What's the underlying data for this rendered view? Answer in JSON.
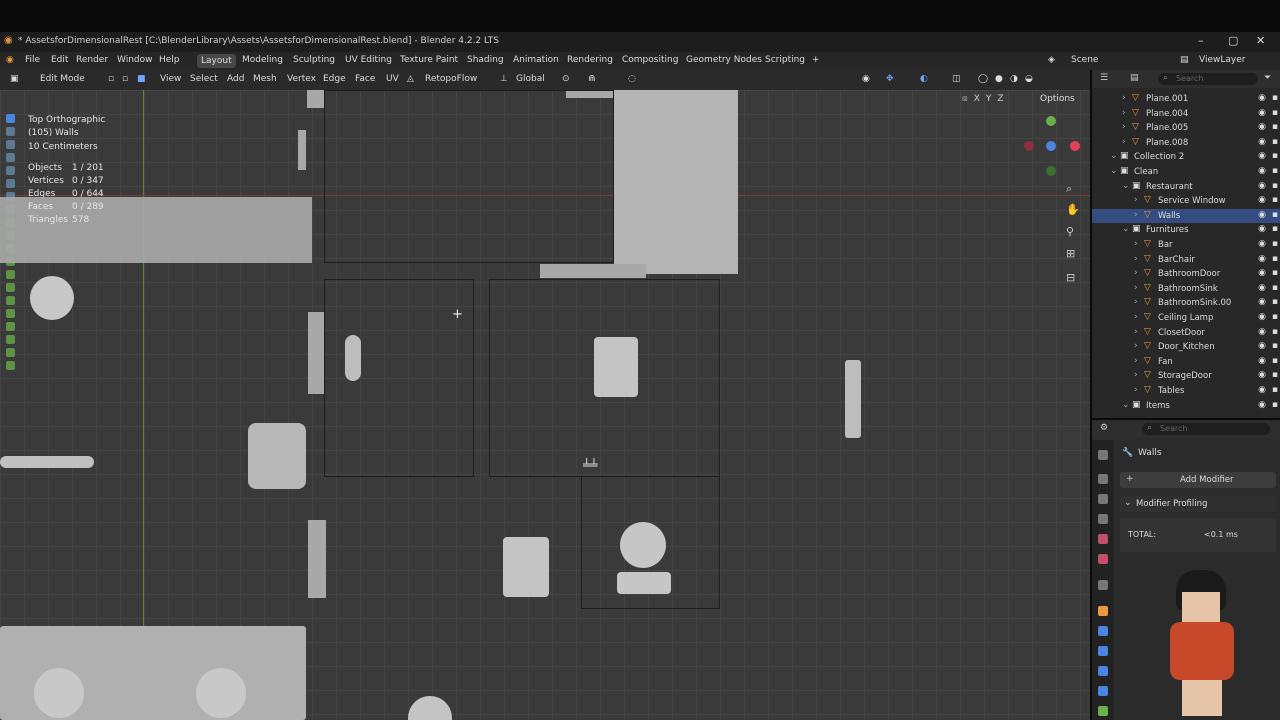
{
  "window": {
    "title": "* AssetsforDimensionalRest [C:\\BlenderLibrary\\Assets\\AssetsforDimensionalRest.blend] - Blender 4.2.2 LTS",
    "min_icon": "minimize-icon",
    "max_icon": "maximize-icon",
    "close_icon": "close-icon"
  },
  "menubar": {
    "menus": [
      "File",
      "Edit",
      "Render",
      "Window",
      "Help"
    ],
    "workspaces": [
      "Layout",
      "Modeling",
      "Sculpting",
      "UV Editing",
      "Texture Paint",
      "Shading",
      "Animation",
      "Rendering",
      "Compositing",
      "Geometry Nodes",
      "Scripting",
      "+"
    ],
    "active_workspace": "Layout",
    "scene": "Scene",
    "view_layer": "ViewLayer"
  },
  "viewport_header": {
    "mode": "Edit Mode",
    "menus": [
      "View",
      "Select",
      "Add",
      "Mesh",
      "Vertex",
      "Edge",
      "Face",
      "UV"
    ],
    "addon": "RetopoFlow",
    "orientation": "Global",
    "options": "Options",
    "axes": [
      "X",
      "Y",
      "Z"
    ]
  },
  "overlay": {
    "view": "Top Orthographic",
    "object": "(105) Walls",
    "scale": "10 Centimeters",
    "stats": [
      {
        "label": "Objects",
        "value": "1 / 201"
      },
      {
        "label": "Vertices",
        "value": "0 / 347"
      },
      {
        "label": "Edges",
        "value": "0 / 644"
      },
      {
        "label": "Faces",
        "value": "0 / 289"
      },
      {
        "label": "Triangles",
        "value": "578"
      }
    ]
  },
  "outliner": {
    "search_placeholder": "Search",
    "rows": [
      {
        "name": "Plane.001",
        "indent": 2,
        "type": "mesh"
      },
      {
        "name": "Plane.004",
        "indent": 2,
        "type": "mesh"
      },
      {
        "name": "Plane.005",
        "indent": 2,
        "type": "mesh"
      },
      {
        "name": "Plane.008",
        "indent": 2,
        "type": "mesh"
      },
      {
        "name": "Collection 2",
        "indent": 1,
        "type": "collection"
      },
      {
        "name": "Clean",
        "indent": 1,
        "type": "collection"
      },
      {
        "name": "Restaurant",
        "indent": 2,
        "type": "collection"
      },
      {
        "name": "Service Window",
        "indent": 3,
        "type": "mesh"
      },
      {
        "name": "Walls",
        "indent": 3,
        "type": "mesh",
        "selected": true
      },
      {
        "name": "Furnitures",
        "indent": 2,
        "type": "collection"
      },
      {
        "name": "Bar",
        "indent": 3,
        "type": "mesh"
      },
      {
        "name": "BarChair",
        "indent": 3,
        "type": "mesh"
      },
      {
        "name": "BathroomDoor",
        "indent": 3,
        "type": "mesh"
      },
      {
        "name": "BathroomSink",
        "indent": 3,
        "type": "mesh"
      },
      {
        "name": "BathroomSink.00",
        "indent": 3,
        "type": "mesh"
      },
      {
        "name": "Ceiling Lamp",
        "indent": 3,
        "type": "mesh"
      },
      {
        "name": "ClosetDoor",
        "indent": 3,
        "type": "mesh"
      },
      {
        "name": "Door_Kitchen",
        "indent": 3,
        "type": "mesh"
      },
      {
        "name": "Fan",
        "indent": 3,
        "type": "mesh"
      },
      {
        "name": "StorageDoor",
        "indent": 3,
        "type": "mesh"
      },
      {
        "name": "Tables",
        "indent": 3,
        "type": "mesh"
      },
      {
        "name": "Items",
        "indent": 2,
        "type": "collection"
      }
    ]
  },
  "properties": {
    "search_placeholder": "Search",
    "object": "Walls",
    "add_modifier": "Add Modifier",
    "panel": "Modifier Profiling",
    "total_label": "TOTAL:",
    "total_value": "<0.1 ms"
  }
}
